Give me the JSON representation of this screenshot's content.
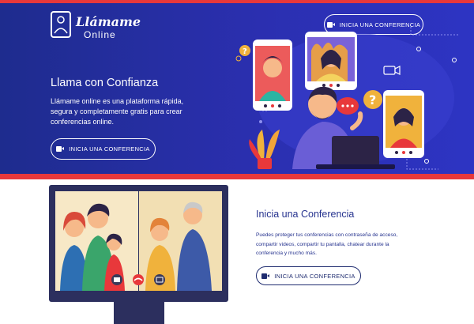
{
  "brand": {
    "title": "Llámame",
    "subtitle": "Online"
  },
  "header": {
    "cta_label": "INICIA UNA CONFERENCIA"
  },
  "hero": {
    "title": "Llama con Confianza",
    "description": "Llámame online es una plataforma rápida, segura y completamente gratis para crear conferencias online.",
    "cta_label": "INICIA UNA CONFERENCIA"
  },
  "section": {
    "title": "Inicia una Conferencia",
    "description": "Puedes proteger tus conferencias con contraseña de acceso, compartir videos, compartir tu pantalla, chatear durante la conferencia y mucho más.",
    "cta_label": "INICIA UNA CONFERENCIA"
  },
  "colors": {
    "hero_bg": "#2b2fb0",
    "accent_red": "#e8383b",
    "text_navy": "#26338f"
  },
  "icons": [
    "video-camera-icon",
    "logo-person-icon",
    "question-icon",
    "chat-bubble-icon",
    "picture-icon",
    "end-call-icon",
    "share-screen-icon"
  ]
}
